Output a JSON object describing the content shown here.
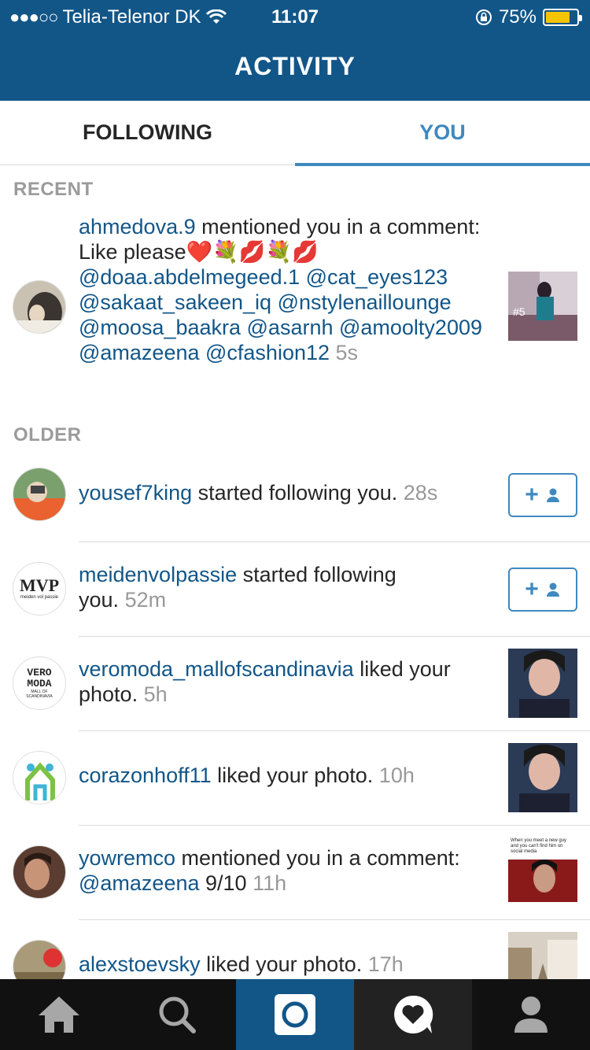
{
  "status_bar": {
    "carrier": "Telia-Telenor DK",
    "time": "11:07",
    "battery": "75%",
    "battery_level": 0.75
  },
  "header": {
    "title": "ACTIVITY"
  },
  "tabs": [
    {
      "label": "FOLLOWING",
      "active": false
    },
    {
      "label": "YOU",
      "active": true
    }
  ],
  "sections": {
    "recent": "RECENT",
    "older": "OLDER"
  },
  "recent": {
    "user": "ahmedova.9",
    "text": "mentioned you in a comment: Like please",
    "emojis": "❤️💐💋💐💋",
    "mentions": "@doaa.abdelmegeed.1 @cat_eyes123 @sakaat_sakeen_iq @nstylenaillounge @moosa_baakra @asarnh @amoolty2009 @amazeena @cfashion12",
    "time": "5s",
    "thumb_label": "#5"
  },
  "older": [
    {
      "user": "yousef7king",
      "text": "started following you.",
      "time": "28s",
      "action": "follow"
    },
    {
      "user": "meidenvolpassie",
      "text": "started following you.",
      "time": "52m",
      "action": "follow",
      "avatar_text": "MVP",
      "avatar_sub": "meiden vol passie"
    },
    {
      "user": "veromoda_mallofscandinavia",
      "text": "liked your photo.",
      "time": "5h",
      "action": "thumb",
      "avatar_text": "VERO MODA",
      "avatar_sub": "MALL OF SCANDINAVIA"
    },
    {
      "user": "corazonhoff11",
      "text": "liked your photo.",
      "time": "10h",
      "action": "thumb"
    },
    {
      "user": "yowremco",
      "text": "mentioned you in a comment:",
      "mention": "@amazeena",
      "extra": "9/10",
      "time": "11h",
      "action": "thumb",
      "thumb_caption": "When you meet a new guy and you can't find him on social media"
    },
    {
      "user": "alexstoevsky",
      "text": "liked your photo.",
      "time": "17h",
      "action": "thumb"
    }
  ],
  "tab_bar": [
    "home-icon",
    "search-icon",
    "camera-icon",
    "activity-icon",
    "profile-icon"
  ],
  "colors": {
    "brand": "#125688",
    "accent": "#3f89c0"
  }
}
